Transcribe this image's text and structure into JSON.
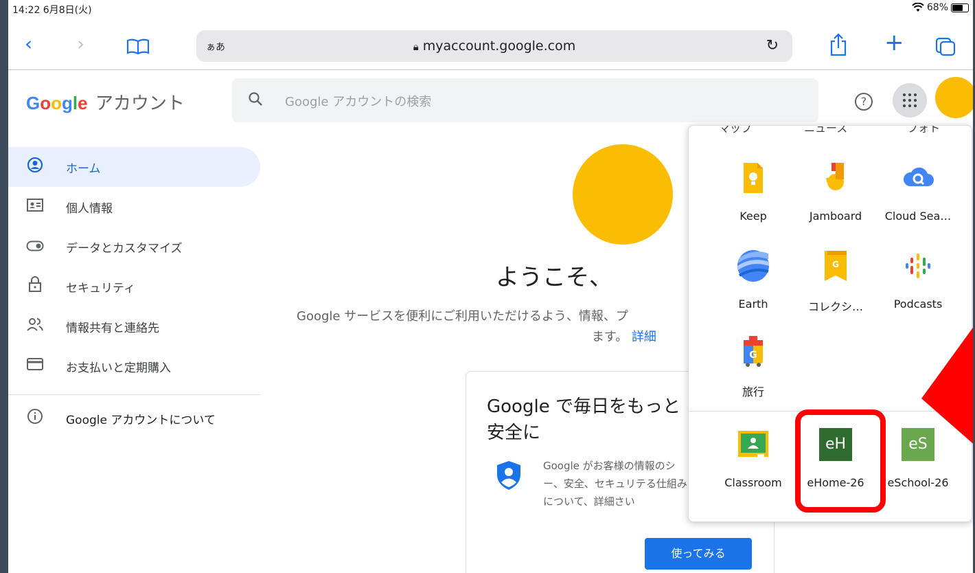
{
  "status_bar": {
    "time": "14:22  6月8日(火)",
    "battery": "68%",
    "wifi_icon": "wifi-icon"
  },
  "browser": {
    "reader_label": "ぁあ",
    "url": "myaccount.google.com",
    "icons": [
      "back-icon",
      "forward-icon",
      "bookmarks-icon",
      "reload-icon",
      "share-icon",
      "new-tab-icon",
      "tabs-icon"
    ]
  },
  "header": {
    "logo_letters": [
      "G",
      "o",
      "o",
      "g",
      "l",
      "e"
    ],
    "logo_colors": [
      "#4285f4",
      "#ea4335",
      "#fbbc04",
      "#4285f4",
      "#34a853",
      "#ea4335"
    ],
    "logo_suffix": "アカウント",
    "search_placeholder": "Google アカウントの検索"
  },
  "sidebar": {
    "items": [
      {
        "label": "ホーム",
        "icon": "account-circle-icon",
        "active": true
      },
      {
        "label": "個人情報",
        "icon": "id-card-icon"
      },
      {
        "label": "データとカスタマイズ",
        "icon": "toggle-icon"
      },
      {
        "label": "セキュリティ",
        "icon": "lock-icon"
      },
      {
        "label": "情報共有と連絡先",
        "icon": "people-icon"
      },
      {
        "label": "お支払いと定期購入",
        "icon": "credit-card-icon"
      }
    ],
    "about_label": "Google アカウントについて"
  },
  "main": {
    "welcome": "ようこそ、",
    "subtext_line1": "Google サービスを便利にご利用いただけるよう、情報、プ",
    "subtext_line2": "ます。",
    "details_link": "詳細",
    "card": {
      "title": "Google で毎日をもっと安全に",
      "body": "Google がお客様の情報のシー、安全、セキュリテる仕組みについて、詳細さい",
      "button": "使ってみる"
    }
  },
  "apps_panel": {
    "cut_labels": [
      "マップ",
      "ニュース",
      "フォト"
    ],
    "rows": [
      [
        "Keep",
        "Jamboard",
        "Cloud Sea…"
      ],
      [
        "Earth",
        "コレクシ…",
        "Podcasts"
      ],
      [
        "旅行"
      ]
    ],
    "bottom_row": [
      "Classroom",
      "eHome-26",
      "eSchool-26"
    ],
    "ehome_tile": "eH",
    "eschool_tile": "eS",
    "accent_color": "#ff0000"
  }
}
